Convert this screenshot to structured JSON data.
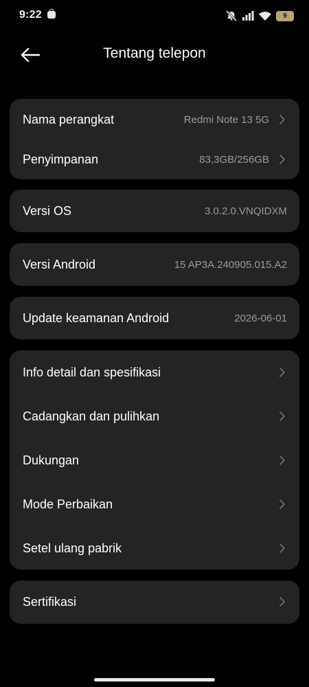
{
  "status_bar": {
    "time": "9:22",
    "battery_level": "9",
    "icons": [
      "app-notification-icon",
      "mute-icon",
      "signal-icon",
      "wifi-icon",
      "battery-icon"
    ]
  },
  "header": {
    "title": "Tentang telepon",
    "back_icon": "back-arrow-icon"
  },
  "groups": {
    "device": {
      "name": {
        "label": "Nama perangkat",
        "value": "Redmi Note 13 5G"
      },
      "storage": {
        "label": "Penyimpanan",
        "value": "83,3GB/256GB"
      }
    },
    "os_version": {
      "label": "Versi OS",
      "value": "3.0.2.0.VNQIDXM"
    },
    "android_version": {
      "label": "Versi Android",
      "value": "15 AP3A.240905.015.A2"
    },
    "security_update": {
      "label": "Update keamanan Android",
      "value": "2026-06-01"
    },
    "more": {
      "details": {
        "label": "Info detail dan spesifikasi"
      },
      "backup": {
        "label": "Cadangkan dan pulihkan"
      },
      "support": {
        "label": "Dukungan"
      },
      "repair": {
        "label": "Mode Perbaikan"
      },
      "factory_reset": {
        "label": "Setel ulang pabrik"
      }
    },
    "certification": {
      "label": "Sertifikasi"
    }
  },
  "colors": {
    "background": "#000000",
    "card": "#242426",
    "value_text": "#9a9a9c",
    "battery": "#b8a676"
  }
}
